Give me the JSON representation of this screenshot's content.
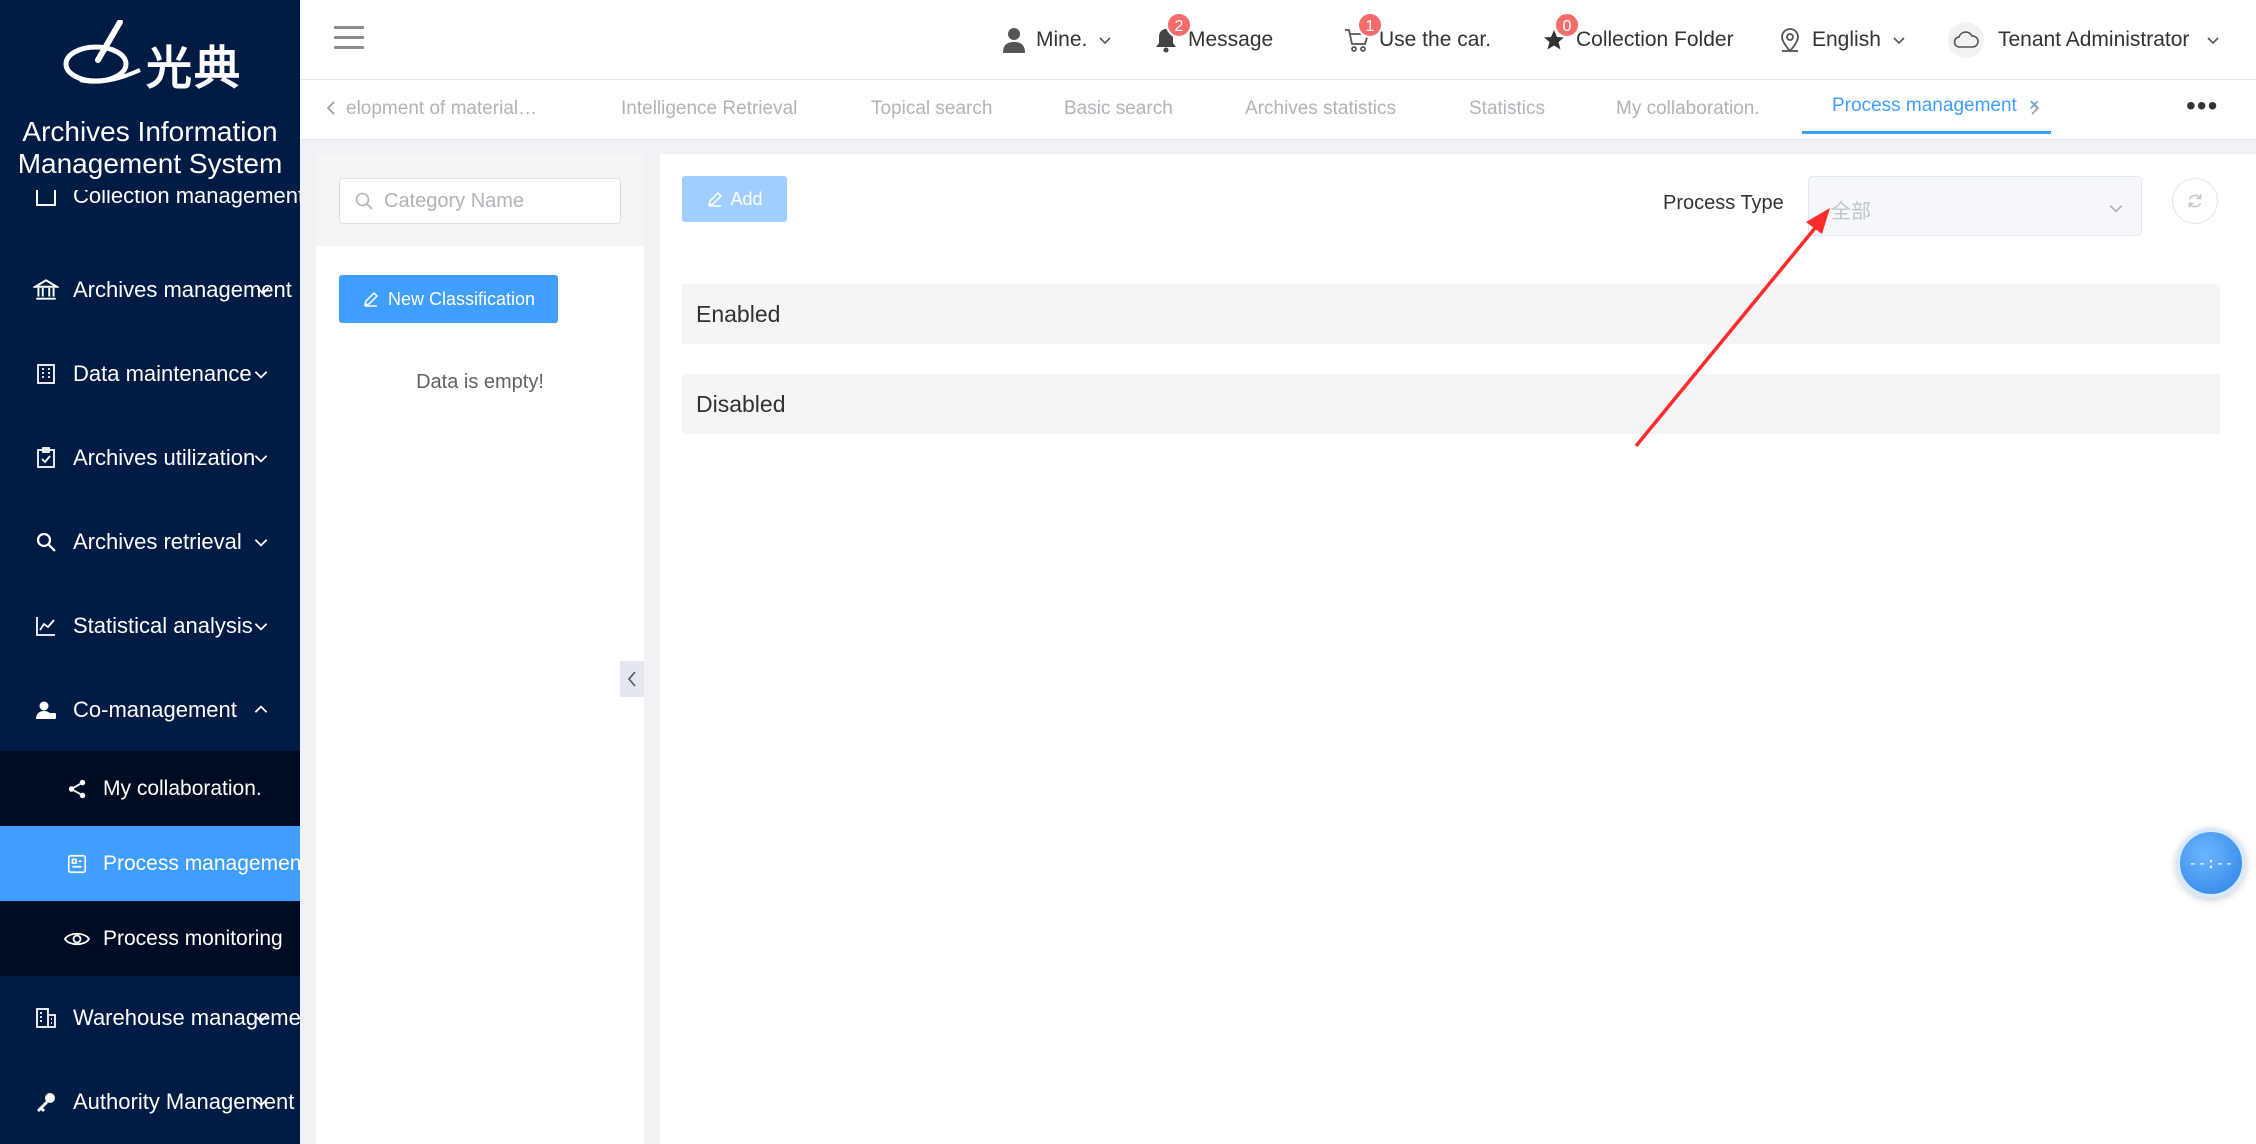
{
  "brand": {
    "logo_text": "光典",
    "system_title_line1": "Archives Information",
    "system_title_line2": "Management System"
  },
  "sidebar": {
    "items": [
      {
        "label": "Collection management",
        "icon": "collection-icon"
      },
      {
        "label": "Archives management",
        "icon": "bank-icon"
      },
      {
        "label": "Data maintenance",
        "icon": "building-icon"
      },
      {
        "label": "Archives utilization",
        "icon": "clipboard-check-icon"
      },
      {
        "label": "Archives retrieval",
        "icon": "search-icon"
      },
      {
        "label": "Statistical analysis",
        "icon": "line-chart-icon"
      },
      {
        "label": "Co-management",
        "icon": "user-group-icon"
      },
      {
        "label": "Warehouse management",
        "icon": "warehouse-icon"
      },
      {
        "label": "Authority Management",
        "icon": "key-icon"
      }
    ],
    "sub_items": [
      {
        "label": "My collaboration.",
        "icon": "share-icon"
      },
      {
        "label": "Process management",
        "icon": "process-icon"
      },
      {
        "label": "Process monitoring",
        "icon": "eye-icon"
      }
    ]
  },
  "header": {
    "user_menu": "Mine.",
    "message_label": "Message",
    "message_count": "2",
    "cart_label": "Use the car.",
    "cart_count": "1",
    "collection_label": "Collection Folder",
    "collection_count": "0",
    "language": "English",
    "tenant": "Tenant Administrator"
  },
  "tabs": [
    {
      "label": "elopment of material…"
    },
    {
      "label": "Intelligence Retrieval"
    },
    {
      "label": "Topical search"
    },
    {
      "label": "Basic search"
    },
    {
      "label": "Archives statistics"
    },
    {
      "label": "Statistics"
    },
    {
      "label": "My collaboration."
    },
    {
      "label": "Process management",
      "active": true
    }
  ],
  "left_panel": {
    "search_placeholder": "Category Name",
    "new_classification_label": "New Classification",
    "empty_text": "Data is empty!"
  },
  "main": {
    "add_label": "Add",
    "process_type_label": "Process Type",
    "process_type_value": "全部",
    "groups": [
      {
        "label": "Enabled"
      },
      {
        "label": "Disabled"
      }
    ]
  },
  "float_timer": "--:--",
  "colors": {
    "sidebar_bg": "#001b44",
    "active_blue": "#409eff",
    "annotation_red": "#ff2a2a"
  }
}
